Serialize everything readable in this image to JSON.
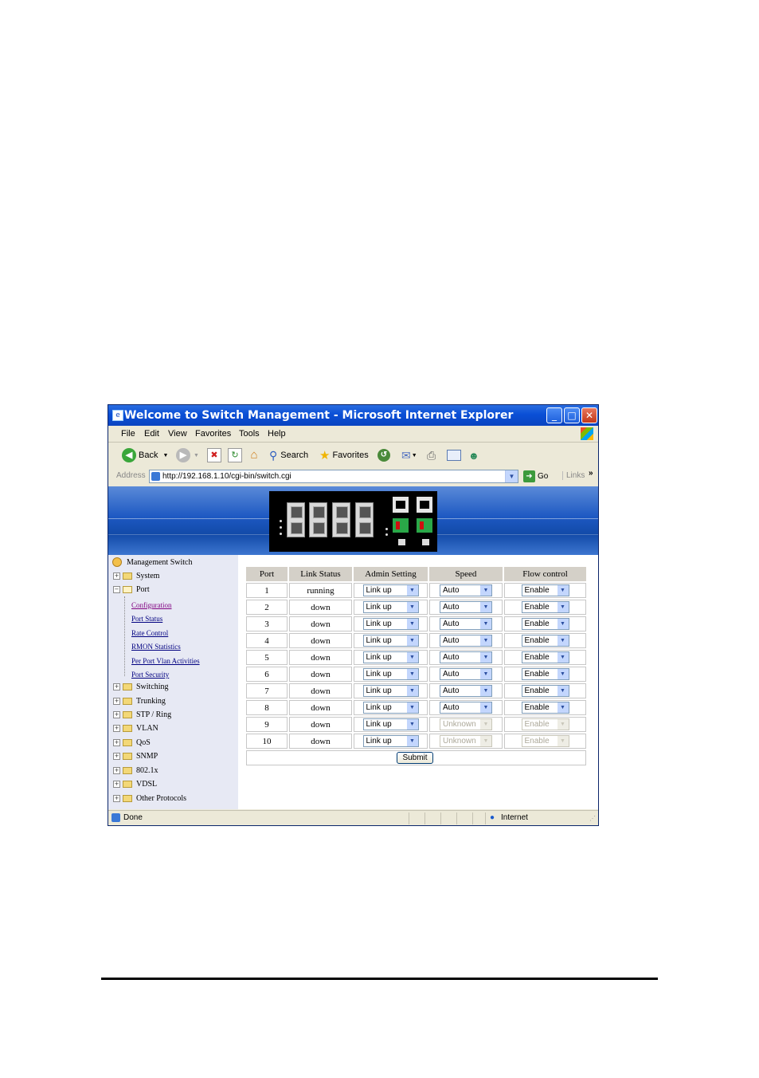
{
  "window": {
    "title": "Welcome to Switch Management - Microsoft Internet Explorer",
    "controls": {
      "minimize": "_",
      "maximize": "□",
      "close": "✕"
    }
  },
  "menu": [
    "File",
    "Edit",
    "View",
    "Favorites",
    "Tools",
    "Help"
  ],
  "toolbar": {
    "back": "Back",
    "search": "Search",
    "favorites": "Favorites"
  },
  "address": {
    "label": "Address",
    "url": "http://192.168.1.10/cgi-bin/switch.cgi",
    "go": "Go",
    "links": "Links"
  },
  "sidebar": {
    "root": "Management Switch",
    "groups": [
      "System",
      "Port",
      "Switching",
      "Trunking",
      "STP / Ring",
      "VLAN",
      "QoS",
      "SNMP",
      "802.1x",
      "VDSL",
      "Other Protocols"
    ],
    "port_children": [
      "Configuration",
      "Port Status",
      "Rate Control",
      "RMON Statistics",
      "Per Port Vlan Activities",
      "Port Security"
    ]
  },
  "table": {
    "headers": [
      "Port",
      "Link Status",
      "Admin Setting",
      "Speed",
      "Flow control"
    ],
    "rows": [
      {
        "port": "1",
        "status": "running",
        "admin": "Link up",
        "speed": "Auto",
        "flow": "Enable"
      },
      {
        "port": "2",
        "status": "down",
        "admin": "Link up",
        "speed": "Auto",
        "flow": "Enable"
      },
      {
        "port": "3",
        "status": "down",
        "admin": "Link up",
        "speed": "Auto",
        "flow": "Enable"
      },
      {
        "port": "4",
        "status": "down",
        "admin": "Link up",
        "speed": "Auto",
        "flow": "Enable"
      },
      {
        "port": "5",
        "status": "down",
        "admin": "Link up",
        "speed": "Auto",
        "flow": "Enable"
      },
      {
        "port": "6",
        "status": "down",
        "admin": "Link up",
        "speed": "Auto",
        "flow": "Enable"
      },
      {
        "port": "7",
        "status": "down",
        "admin": "Link up",
        "speed": "Auto",
        "flow": "Enable"
      },
      {
        "port": "8",
        "status": "down",
        "admin": "Link up",
        "speed": "Auto",
        "flow": "Enable"
      },
      {
        "port": "9",
        "status": "down",
        "admin": "Link up",
        "speed": "Unknown",
        "flow": "Enable"
      },
      {
        "port": "10",
        "status": "down",
        "admin": "Link up",
        "speed": "Unknown",
        "flow": "Enable"
      }
    ],
    "submit": "Submit"
  },
  "status": {
    "left": "Done",
    "zone": "Internet"
  },
  "colors": {
    "titlebar": "#0a4fd6",
    "chrome": "#ece9d8",
    "sidebar": "#e7e9f4",
    "link": "#000080",
    "visited": "#800080"
  }
}
